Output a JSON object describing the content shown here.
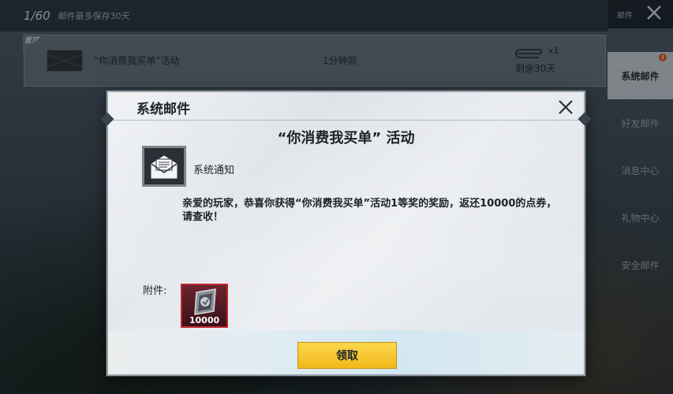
{
  "top_bar": {
    "mail_count": "1/60",
    "note": "邮件最多保存30天",
    "right_label": "邮件"
  },
  "mail_row": {
    "tag": "置顶",
    "title": "“你消费我买单”活动",
    "time": "1分钟前",
    "attachment_count": "x1",
    "remaining": "剩余30天"
  },
  "sidebar": {
    "items": [
      {
        "label": "系统邮件",
        "active": true,
        "badge": "!"
      },
      {
        "label": "好友邮件"
      },
      {
        "label": "消息中心"
      },
      {
        "label": "礼物中心"
      },
      {
        "label": "安全邮件"
      }
    ]
  },
  "dialog": {
    "header_title": "系统邮件",
    "subject": "“你消费我买单” 活动",
    "sender": "系统通知",
    "body": "亲爱的玩家，恭喜你获得“你消费我买单”活动1等奖的奖励，返还10000的点券，请查收！",
    "attachment_label": "附件:",
    "attachment_quantity": "10000",
    "claim_label": "领取"
  },
  "colors": {
    "claim_button": "#f2b91c",
    "attachment_border": "#c0242e",
    "badge": "#d45420"
  }
}
